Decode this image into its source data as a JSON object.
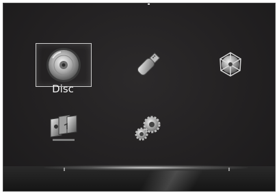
{
  "menu": {
    "items": [
      {
        "label": "Disc",
        "icon": "disc-icon",
        "selected": true
      },
      {
        "label": "",
        "icon": "usb-drive-icon",
        "selected": false
      },
      {
        "label": "",
        "icon": "network-icon",
        "selected": false
      },
      {
        "label": "",
        "icon": "media-library-icon",
        "selected": false
      },
      {
        "label": "",
        "icon": "settings-gears-icon",
        "selected": false
      }
    ]
  },
  "colors": {
    "background": "#222021",
    "highlight": "#cfcfcf",
    "label": "#f2f2f2"
  }
}
